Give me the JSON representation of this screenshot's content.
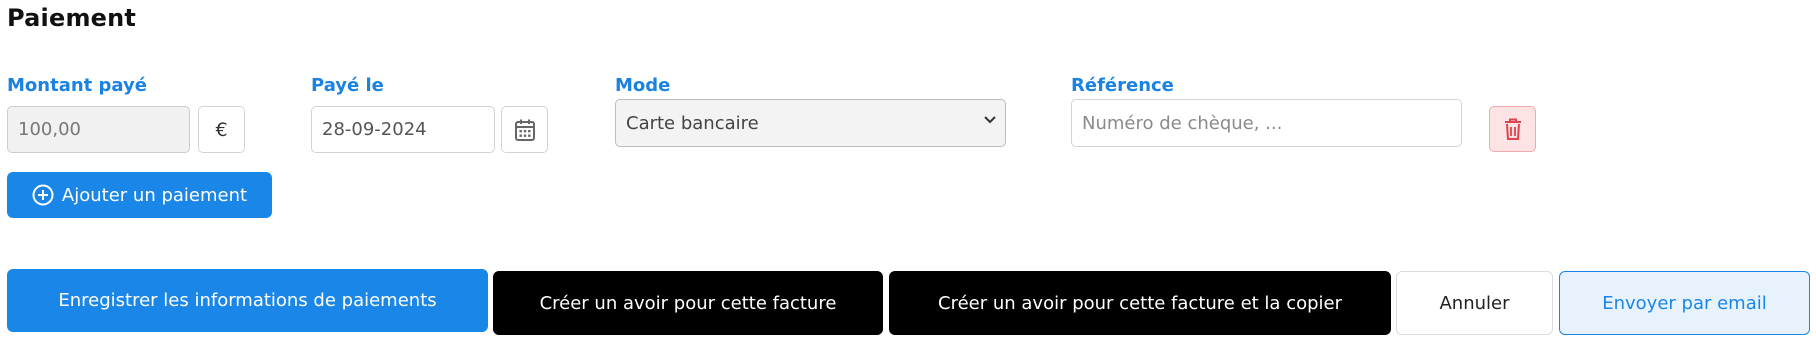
{
  "section_title": "Paiement",
  "payment": {
    "amount": {
      "label": "Montant payé",
      "value": "100,00",
      "currency": "€"
    },
    "date": {
      "label": "Payé le",
      "value": "28-09-2024"
    },
    "mode": {
      "label": "Mode",
      "selected": "Carte bancaire"
    },
    "reference": {
      "label": "Référence",
      "placeholder": "Numéro de chèque, ..."
    }
  },
  "add_payment_label": "Ajouter un paiement",
  "actions": {
    "save": "Enregistrer les informations de paiements",
    "credit_note": "Créer un avoir pour cette facture",
    "credit_note_copy": "Créer un avoir pour cette facture et la copier",
    "cancel": "Annuler",
    "send_email": "Envoyer par email"
  },
  "colors": {
    "accent": "#1a86e8",
    "label": "#1a82e2",
    "danger": "#e0434b",
    "danger_bg": "#fde3e4"
  },
  "icons": {
    "calendar": "calendar-icon",
    "trash": "trash-icon",
    "add": "plus-circle-icon",
    "select": "chevron-down-icon"
  }
}
